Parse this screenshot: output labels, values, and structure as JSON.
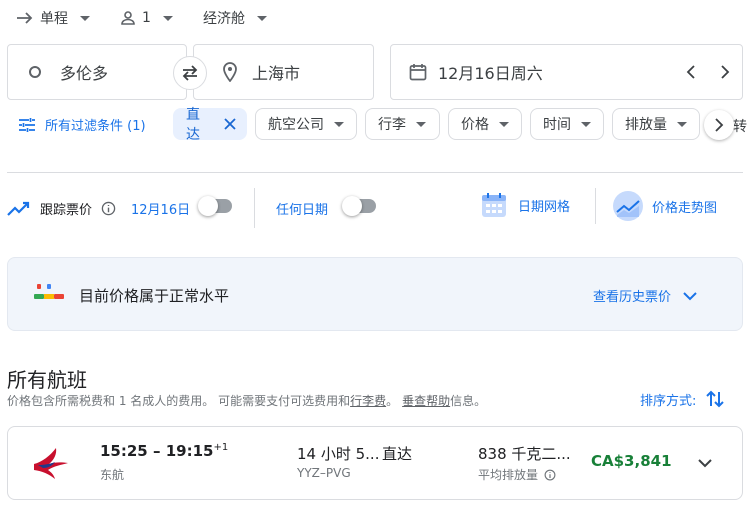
{
  "top_options": {
    "trip_type": "单程",
    "passengers": "1",
    "cabin": "经济舱"
  },
  "search": {
    "origin": "多伦多",
    "destination": "上海市",
    "date": "12月16日周六"
  },
  "filters": {
    "all_filters": "所有过滤条件 (1)",
    "nonstop": "直达",
    "airlines": "航空公司",
    "bags": "行李",
    "price": "价格",
    "times": "时间",
    "emissions": "排放量",
    "overflow": "转"
  },
  "tracking": {
    "track_label": "跟踪票价",
    "date_label": "12月16日",
    "date_toggle": false,
    "any_dates_label": "任何日期",
    "any_dates_toggle": false,
    "date_grid": "日期网格",
    "price_graph": "价格走势图"
  },
  "insight": {
    "text": "目前价格属于正常水平",
    "history_link": "查看历史票价"
  },
  "results": {
    "heading": "所有航班",
    "note_prefix": "价格包含所需税费和 1 名成人的费用。 可能需要支付可选费用和",
    "note_link1": "行李费",
    "note_mid": "。",
    "note_link2": "垂查帮助",
    "note_suffix": "信息。",
    "sort_label": "排序方式:"
  },
  "flight": {
    "depart": "15:25",
    "dash": " – ",
    "arrive": "19:15",
    "day_offset": "+1",
    "airline": "东航",
    "duration": "14 小时 5...",
    "stops": "直达",
    "route": "YYZ–PVG",
    "emissions": "838 千克二...",
    "emissions_note": "平均排放量",
    "price": "CA$3,841"
  },
  "colors": {
    "accent": "#1a73e8",
    "price_green": "#188038",
    "chip_active_bg": "#e8f0fe"
  }
}
